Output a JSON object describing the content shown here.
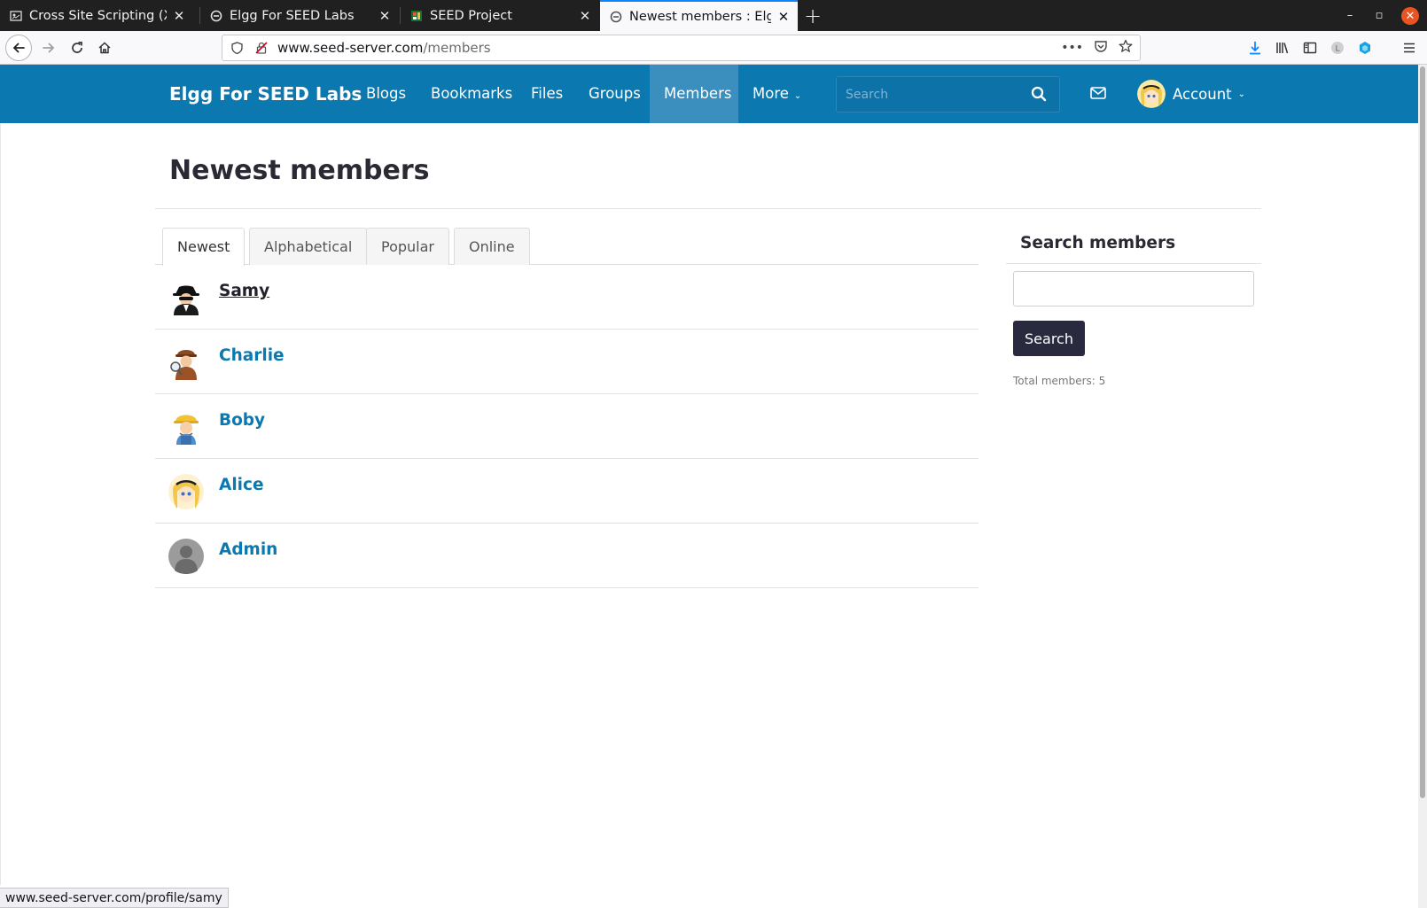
{
  "browser": {
    "tabs": [
      {
        "title": "Cross Site Scripting (XSS)",
        "active": false
      },
      {
        "title": "Elgg For SEED Labs",
        "active": false
      },
      {
        "title": "SEED Project",
        "active": false
      },
      {
        "title": "Newest members : Elgg For SEED Labs",
        "active": true
      }
    ],
    "url_host": "www.seed-server.com",
    "url_path": "/members",
    "status_url": "www.seed-server.com/profile/samy"
  },
  "site": {
    "brand": "Elgg For SEED Labs",
    "menu": [
      {
        "label": "Blogs"
      },
      {
        "label": "Bookmarks"
      },
      {
        "label": "Files"
      },
      {
        "label": "Groups"
      },
      {
        "label": "Members"
      },
      {
        "label": "More"
      }
    ],
    "search_placeholder": "Search",
    "account_label": "Account"
  },
  "page": {
    "title": "Newest members",
    "tabs": [
      {
        "label": "Newest"
      },
      {
        "label": "Alphabetical"
      },
      {
        "label": "Popular"
      },
      {
        "label": "Online"
      }
    ],
    "members": [
      {
        "name": "Samy",
        "avatar": "spy-avatar"
      },
      {
        "name": "Charlie",
        "avatar": "detective-avatar"
      },
      {
        "name": "Boby",
        "avatar": "builder-avatar"
      },
      {
        "name": "Alice",
        "avatar": "alice-avatar"
      },
      {
        "name": "Admin",
        "avatar": "default-user-avatar"
      }
    ]
  },
  "sidebar": {
    "title": "Search members",
    "button_label": "Search",
    "total_text": "Total members: 5"
  },
  "colors": {
    "header": "#0b78b0",
    "link": "#0b78b0",
    "button": "#2a2a3f"
  }
}
